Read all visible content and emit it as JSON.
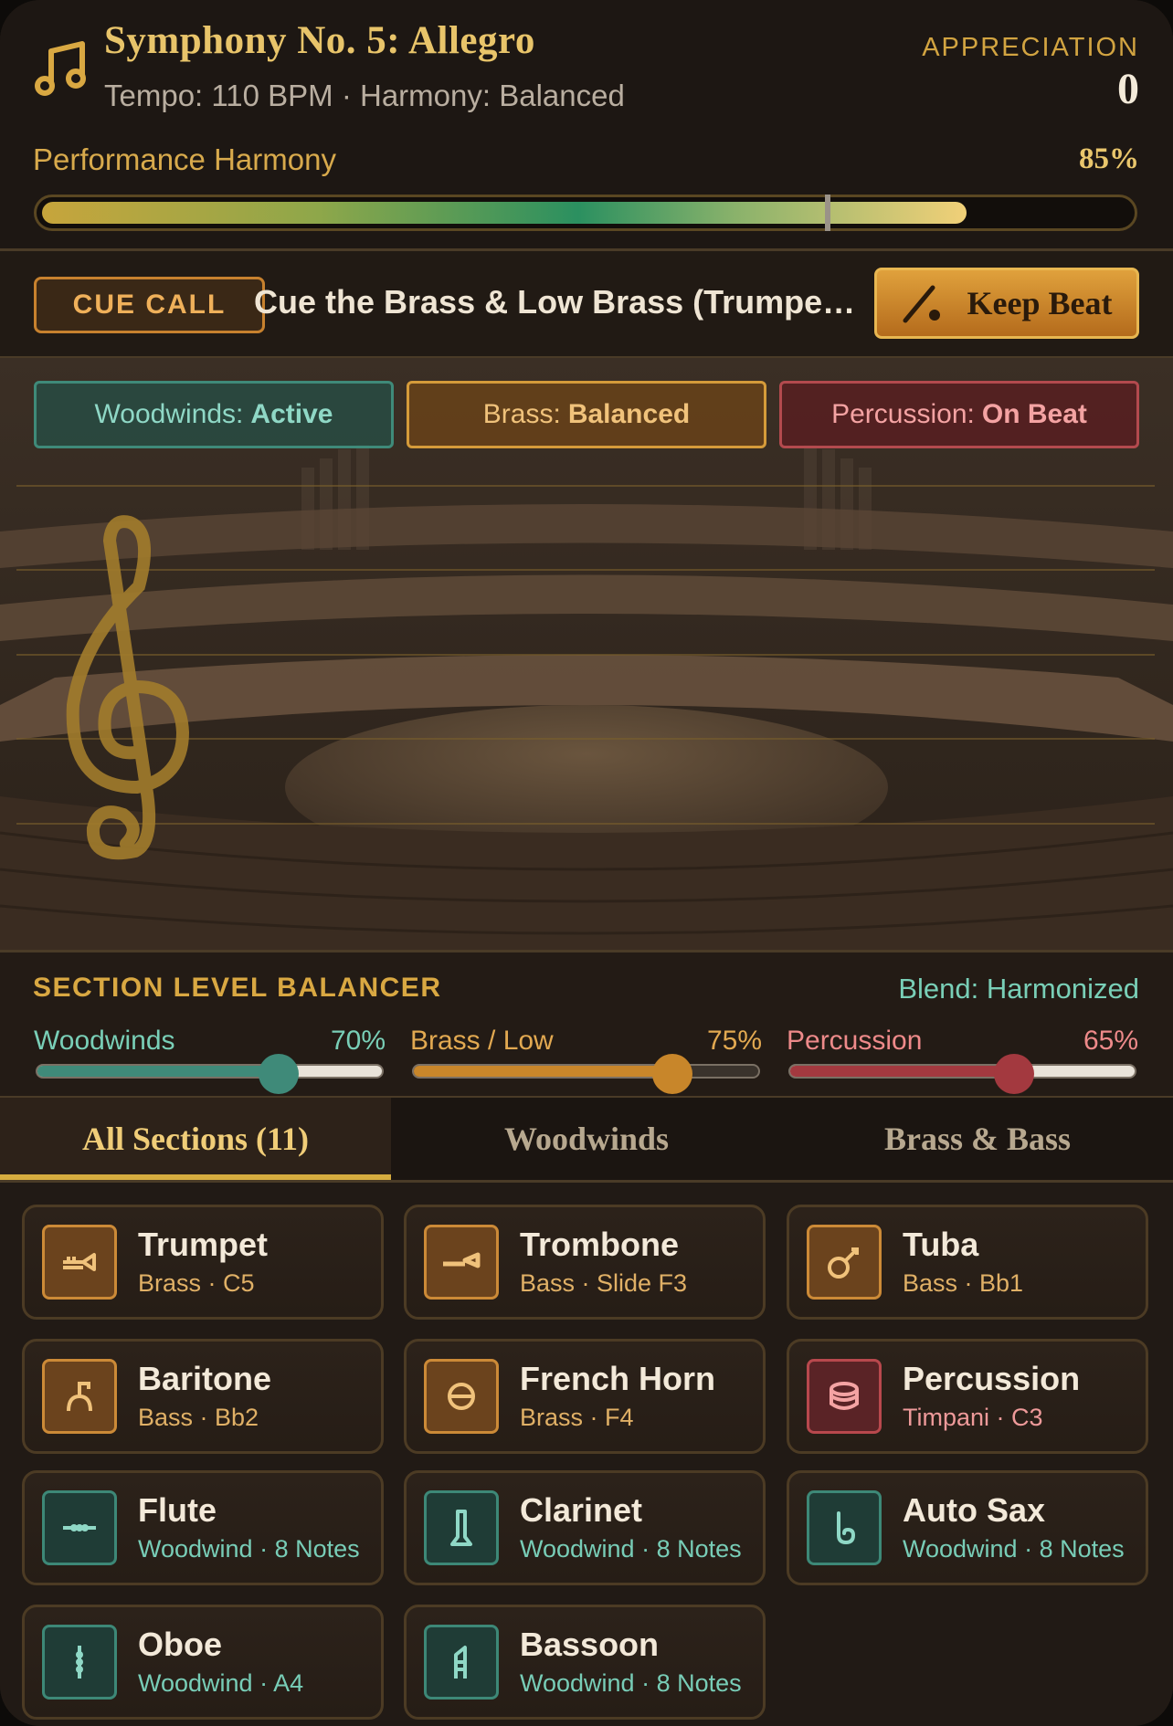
{
  "header": {
    "title": "Symphony No. 5: Allegro",
    "subtitle": "Tempo: 110 BPM · Harmony: Balanced",
    "appreciation_label": "APPRECIATION",
    "appreciation_value": "0",
    "performance_label": "Performance Harmony",
    "performance_value": "85%",
    "performance_fraction": 0.85,
    "target_marker_fraction": 0.72
  },
  "cue": {
    "badge": "CUE CALL",
    "text": "Cue the Brass & Low Brass (Trumpet, Trombone, Tuba)",
    "button_label": "Keep Beat"
  },
  "status": [
    {
      "section": "Woodwinds:",
      "state": "Active"
    },
    {
      "section": "Brass:",
      "state": "Balanced"
    },
    {
      "section": "Percussion:",
      "state": "On Beat"
    }
  ],
  "balancer": {
    "title": "SECTION LEVEL BALANCER",
    "blend": "Blend: Harmonized",
    "sliders": [
      {
        "label": "Woodwinds",
        "value_text": "70%",
        "value": 0.7,
        "color": "#3f8a79"
      },
      {
        "label": "Brass / Low",
        "value_text": "75%",
        "value": 0.75,
        "color": "#c8862a"
      },
      {
        "label": "Percussion",
        "value_text": "65%",
        "value": 0.65,
        "color": "#a3393f"
      }
    ]
  },
  "tabs": [
    {
      "label": "All Sections (11)",
      "active": true
    },
    {
      "label": "Woodwinds",
      "active": false
    },
    {
      "label": "Brass & Bass",
      "active": false
    }
  ],
  "instruments": [
    {
      "name": "Trumpet",
      "detail": "Brass · C5",
      "family": "brass",
      "icon": "trumpet-icon"
    },
    {
      "name": "Trombone",
      "detail": "Bass · Slide F3",
      "family": "brass",
      "icon": "trombone-icon"
    },
    {
      "name": "Tuba",
      "detail": "Bass · Bb1",
      "family": "brass",
      "icon": "tuba-icon"
    },
    {
      "name": "Baritone",
      "detail": "Bass · Bb2",
      "family": "brass",
      "icon": "baritone-icon"
    },
    {
      "name": "French Horn",
      "detail": "Brass · F4",
      "family": "brass",
      "icon": "french-horn-icon"
    },
    {
      "name": "Percussion",
      "detail": "Timpani · C3",
      "family": "perc",
      "icon": "timpani-icon"
    },
    {
      "name": "Flute",
      "detail": "Woodwind · 8 Notes",
      "family": "wood",
      "icon": "flute-icon"
    },
    {
      "name": "Clarinet",
      "detail": "Woodwind · 8 Notes",
      "family": "wood",
      "icon": "clarinet-icon"
    },
    {
      "name": "Auto Sax",
      "detail": "Woodwind · 8 Notes",
      "family": "wood",
      "icon": "saxophone-icon"
    },
    {
      "name": "Oboe",
      "detail": "Woodwind · A4",
      "family": "wood",
      "icon": "oboe-icon"
    },
    {
      "name": "Bassoon",
      "detail": "Woodwind · 8 Notes",
      "family": "wood",
      "icon": "bassoon-icon"
    }
  ],
  "colors": {
    "gold": "#e8c46a",
    "brass": "#cc8a37",
    "woodwind": "#3d8877",
    "percussion": "#b8484d"
  }
}
